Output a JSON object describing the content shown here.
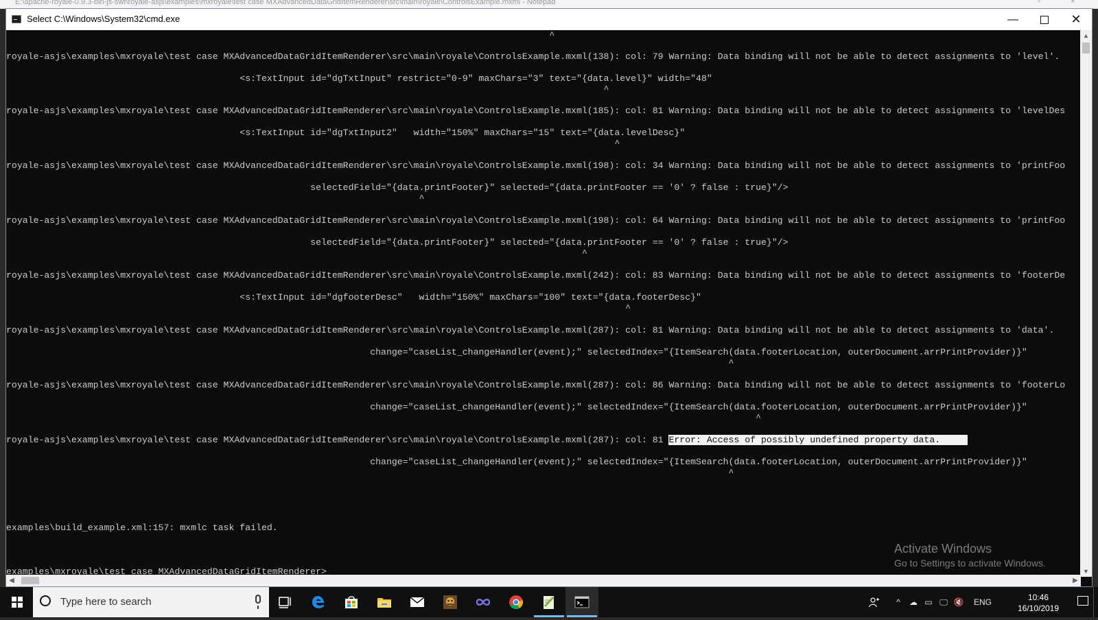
{
  "background_window": {
    "title": "E:\\apache-royale-0.9.3-bin-js-swf\\royale-asjs\\examples\\mxroyale\\test case MXAdvancedDataGridItemRenderer\\src\\main\\royale\\ControlsExample.mxml - Notepad"
  },
  "window": {
    "title": "Select C:\\Windows\\System32\\cmd.exe"
  },
  "console": {
    "lines": [
      "                                                                                                    ^",
      "royale-asjs\\examples\\mxroyale\\test case MXAdvancedDataGridItemRenderer\\src\\main\\royale\\ControlsExample.mxml(138): col: 79 Warning: Data binding will not be able to detect assignments to 'level'.",
      "                                           <s:TextInput id=\"dgTxtInput\" restrict=\"0-9\" maxChars=\"3\" text=\"{data.level}\" width=\"48\"",
      "                                                                                                              ^",
      "royale-asjs\\examples\\mxroyale\\test case MXAdvancedDataGridItemRenderer\\src\\main\\royale\\ControlsExample.mxml(185): col: 81 Warning: Data binding will not be able to detect assignments to 'levelDes",
      "                                           <s:TextInput id=\"dgTxtInput2\"   width=\"150%\" maxChars=\"15\" text=\"{data.levelDesc}\"",
      "                                                                                                                ^",
      "royale-asjs\\examples\\mxroyale\\test case MXAdvancedDataGridItemRenderer\\src\\main\\royale\\ControlsExample.mxml(198): col: 34 Warning: Data binding will not be able to detect assignments to 'printFoo",
      "                                                        selectedField=\"{data.printFooter}\" selected=\"{data.printFooter == '0' ? false : true}\"/>",
      "                                                                            ^",
      "royale-asjs\\examples\\mxroyale\\test case MXAdvancedDataGridItemRenderer\\src\\main\\royale\\ControlsExample.mxml(198): col: 64 Warning: Data binding will not be able to detect assignments to 'printFoo",
      "                                                        selectedField=\"{data.printFooter}\" selected=\"{data.printFooter == '0' ? false : true}\"/>",
      "                                                                                                          ^",
      "royale-asjs\\examples\\mxroyale\\test case MXAdvancedDataGridItemRenderer\\src\\main\\royale\\ControlsExample.mxml(242): col: 83 Warning: Data binding will not be able to detect assignments to 'footerDe",
      "                                           <s:TextInput id=\"dgfooterDesc\"   width=\"150%\" maxChars=\"100\" text=\"{data.footerDesc}\"",
      "                                                                                                                  ^",
      "royale-asjs\\examples\\mxroyale\\test case MXAdvancedDataGridItemRenderer\\src\\main\\royale\\ControlsExample.mxml(287): col: 81 Warning: Data binding will not be able to detect assignments to 'data'.",
      "                                                                   change=\"caseList_changeHandler(event);\" selectedIndex=\"{ItemSearch(data.footerLocation, outerDocument.arrPrintProvider)}\"",
      "                                                                                                                                     ^",
      "royale-asjs\\examples\\mxroyale\\test case MXAdvancedDataGridItemRenderer\\src\\main\\royale\\ControlsExample.mxml(287): col: 86 Warning: Data binding will not be able to detect assignments to 'footerLo",
      "                                                                   change=\"caseList_changeHandler(event);\" selectedIndex=\"{ItemSearch(data.footerLocation, outerDocument.arrPrintProvider)}\"",
      "                                                                                                                                          ^"
    ],
    "error_line_prefix": "royale-asjs\\examples\\mxroyale\\test case MXAdvancedDataGridItemRenderer\\src\\main\\royale\\ControlsExample.mxml(287): col: 81 ",
    "error_message": "Error: Access of possibly undefined property data.     ",
    "error_context": "                                                                   change=\"caseList_changeHandler(event);\" selectedIndex=\"{ItemSearch(data.footerLocation, outerDocument.arrPrintProvider)}\"",
    "error_caret": "                                                                                                                                     ^",
    "failed_line": "examples\\build_example.xml:157: mxmlc task failed.",
    "prompt": "examples\\mxroyale\\test case MXAdvancedDataGridItemRenderer>"
  },
  "watermark": {
    "title": "Activate Windows",
    "subtitle": "Go to Settings to activate Windows."
  },
  "taskbar": {
    "search_placeholder": "Type here to search",
    "icons": [
      "task-view-icon",
      "edge-icon",
      "store-icon",
      "file-explorer-icon",
      "mail-icon",
      "app-icon",
      "infinity-app-icon",
      "chrome-icon",
      "notepad-plus-icon",
      "cmd-icon"
    ],
    "tray": {
      "language": "ENG",
      "time": "10:46",
      "date": "16/10/2019"
    }
  },
  "colors": {
    "console_bg": "#0c0c0c",
    "console_fg": "#cccccc",
    "taskbar_bg": "#101010",
    "accent": "#76b9ed"
  }
}
